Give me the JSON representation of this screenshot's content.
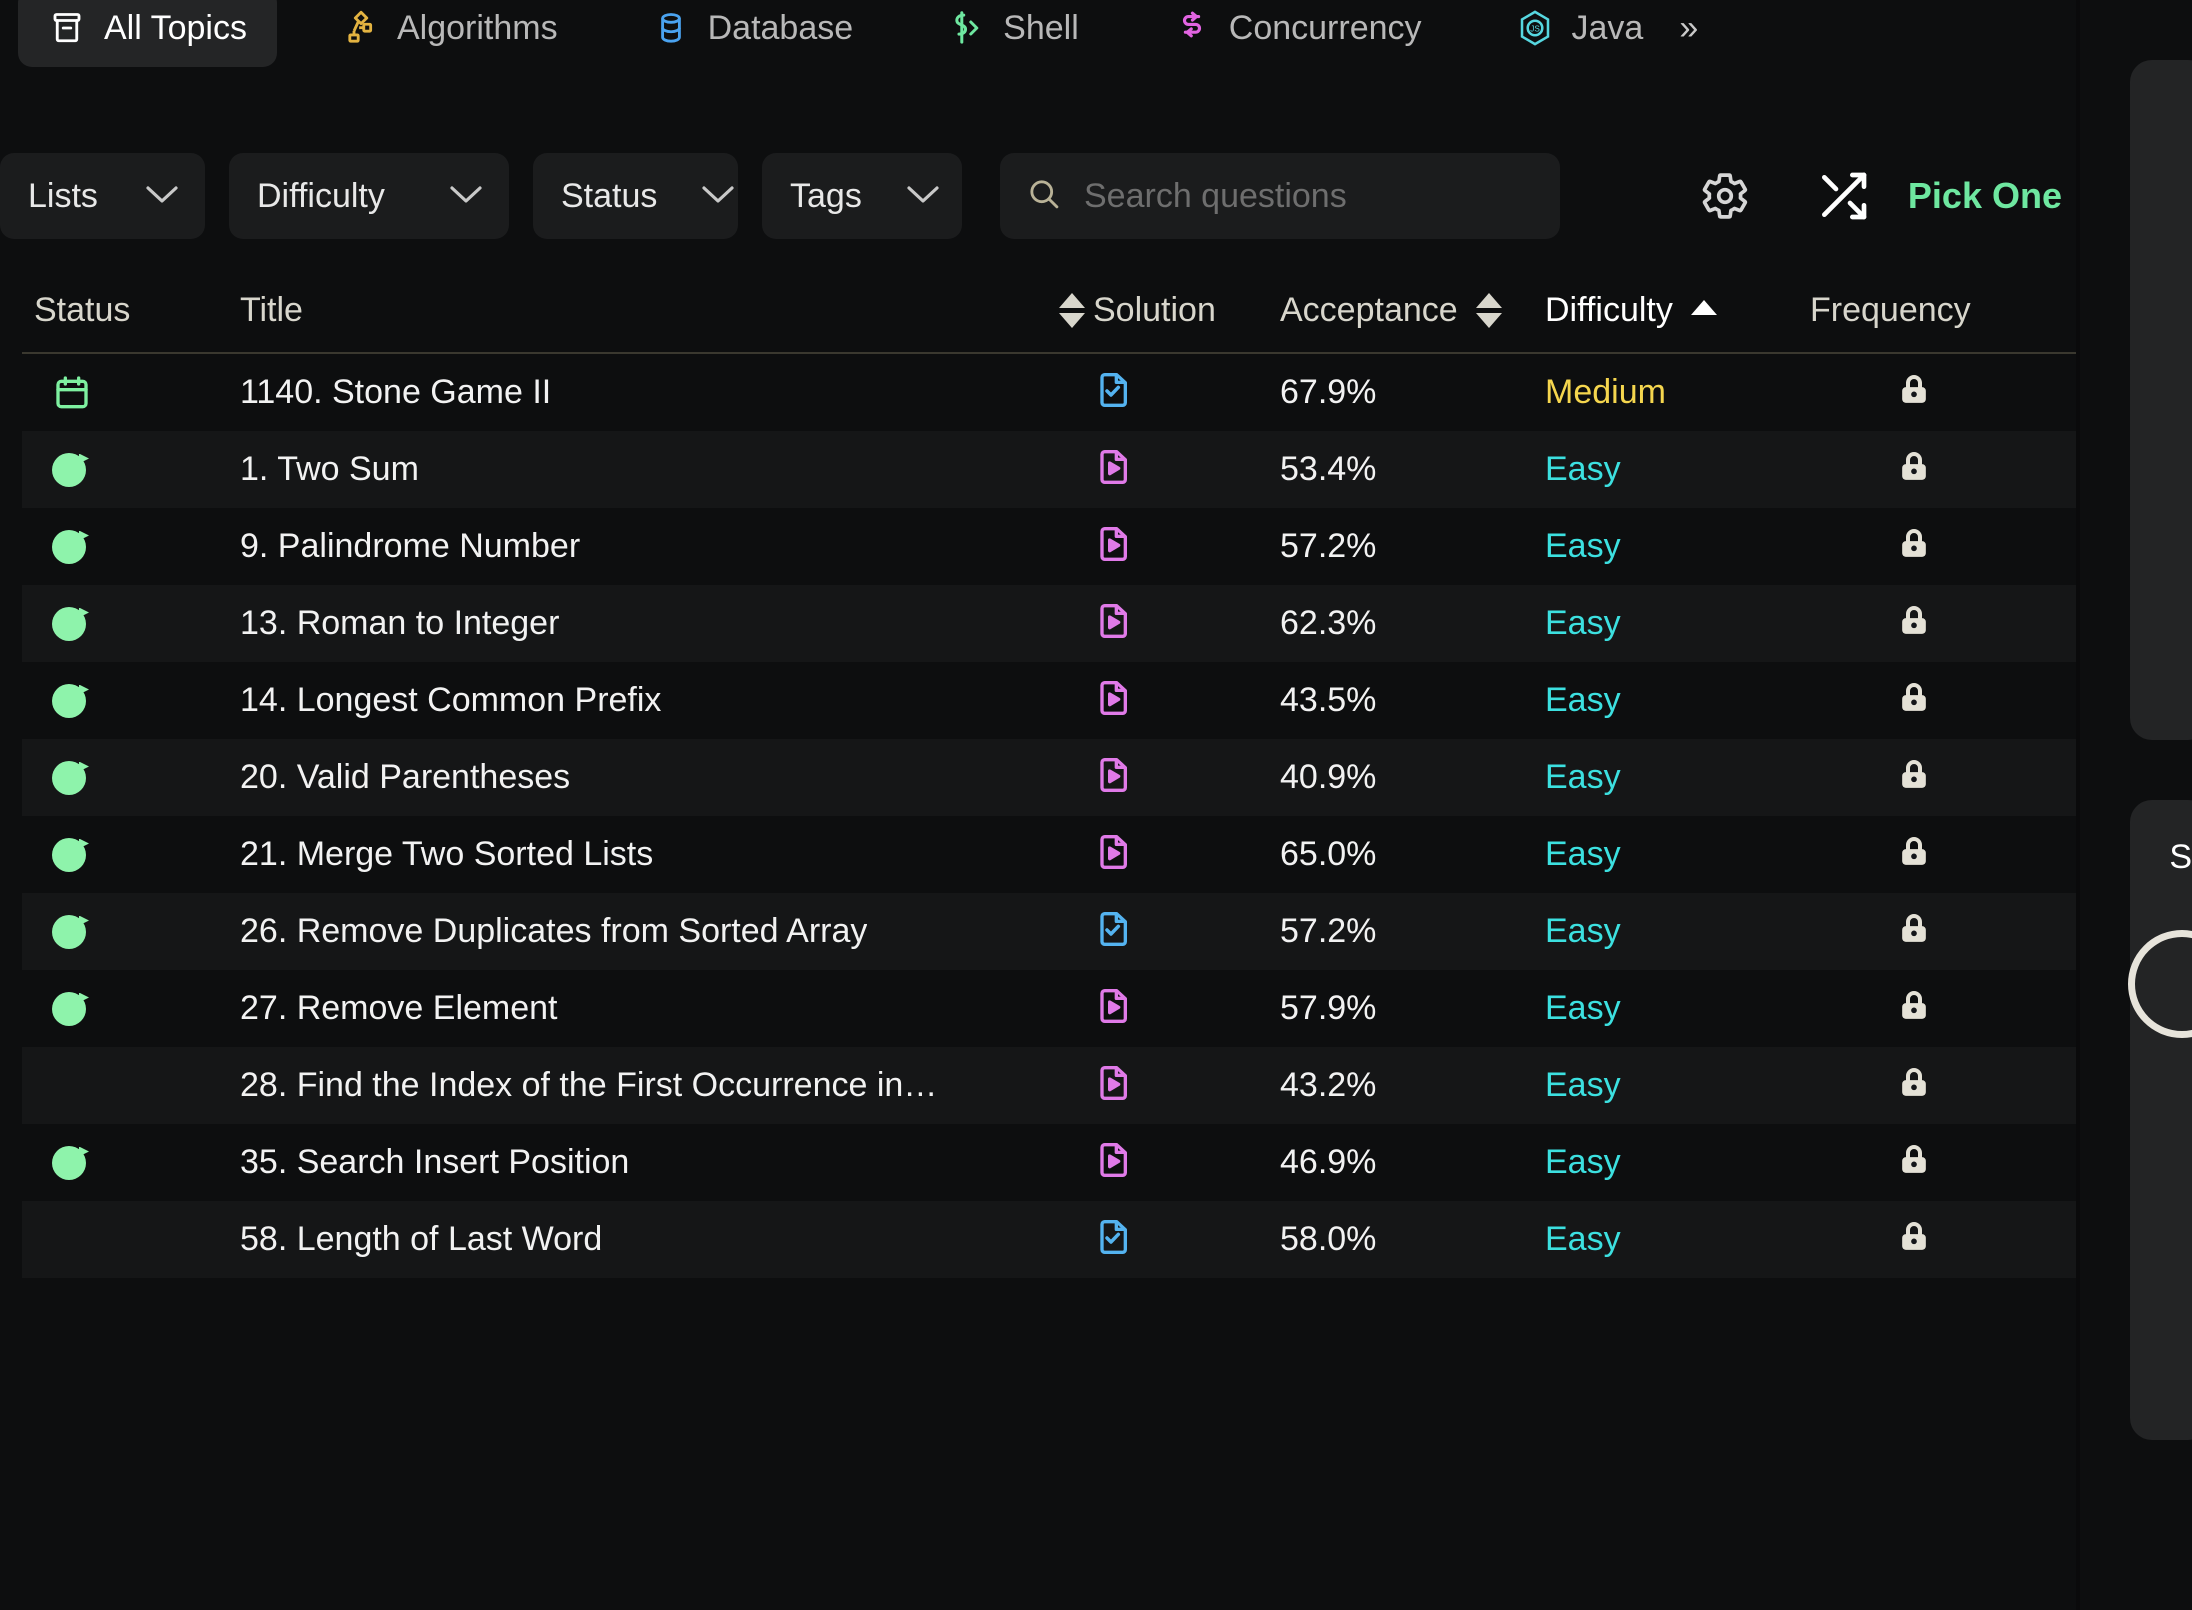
{
  "topics": [
    {
      "label": "All Topics",
      "icon": "archive-icon",
      "active": true,
      "color": "#ffffff"
    },
    {
      "label": "Algorithms",
      "icon": "algorithms-icon",
      "active": false,
      "color": "#e3b341"
    },
    {
      "label": "Database",
      "icon": "database-icon",
      "active": false,
      "color": "#4aa3f0"
    },
    {
      "label": "Shell",
      "icon": "shell-icon",
      "active": false,
      "color": "#6ee7a0"
    },
    {
      "label": "Concurrency",
      "icon": "concurrency-icon",
      "active": false,
      "color": "#e264e2"
    },
    {
      "label": "Java",
      "icon": "js-hexagon-icon",
      "active": false,
      "color": "#56d7e0"
    }
  ],
  "topics_more_label": "»",
  "filters": {
    "lists": {
      "label": "Lists",
      "caret": "⌄"
    },
    "difficulty": {
      "label": "Difficulty",
      "caret": "⌄"
    },
    "status": {
      "label": "Status",
      "caret": "⌄"
    },
    "tags": {
      "label": "Tags",
      "caret": "⌄"
    }
  },
  "search": {
    "value": "",
    "placeholder": "Search questions"
  },
  "actions": {
    "settings_icon": "gear-icon",
    "shuffle_icon": "shuffle-icon",
    "pick_one_label": "Pick One",
    "pick_one_color": "#6ee7a0"
  },
  "table": {
    "columns": {
      "status": "Status",
      "title": "Title",
      "solution": "Solution",
      "acceptance": "Acceptance",
      "difficulty": "Difficulty",
      "frequency": "Frequency"
    },
    "sort": {
      "active_column": "Difficulty",
      "direction": "asc"
    },
    "rows": [
      {
        "status": "daily",
        "status_icon": "calendar-icon",
        "title": "1140. Stone Game II",
        "solution_icon": "document-check-icon",
        "solution_type": "article",
        "acceptance": "67.9%",
        "difficulty": "Medium",
        "frequency_icon": "lock-icon"
      },
      {
        "status": "solved",
        "status_icon": "solved-check-icon",
        "title": "1. Two Sum",
        "solution_icon": "document-play-icon",
        "solution_type": "video",
        "acceptance": "53.4%",
        "difficulty": "Easy",
        "frequency_icon": "lock-icon"
      },
      {
        "status": "solved",
        "status_icon": "solved-check-icon",
        "title": "9. Palindrome Number",
        "solution_icon": "document-play-icon",
        "solution_type": "video",
        "acceptance": "57.2%",
        "difficulty": "Easy",
        "frequency_icon": "lock-icon"
      },
      {
        "status": "solved",
        "status_icon": "solved-check-icon",
        "title": "13. Roman to Integer",
        "solution_icon": "document-play-icon",
        "solution_type": "video",
        "acceptance": "62.3%",
        "difficulty": "Easy",
        "frequency_icon": "lock-icon"
      },
      {
        "status": "solved",
        "status_icon": "solved-check-icon",
        "title": "14. Longest Common Prefix",
        "solution_icon": "document-play-icon",
        "solution_type": "video",
        "acceptance": "43.5%",
        "difficulty": "Easy",
        "frequency_icon": "lock-icon"
      },
      {
        "status": "solved",
        "status_icon": "solved-check-icon",
        "title": "20. Valid Parentheses",
        "solution_icon": "document-play-icon",
        "solution_type": "video",
        "acceptance": "40.9%",
        "difficulty": "Easy",
        "frequency_icon": "lock-icon"
      },
      {
        "status": "solved",
        "status_icon": "solved-check-icon",
        "title": "21. Merge Two Sorted Lists",
        "solution_icon": "document-play-icon",
        "solution_type": "video",
        "acceptance": "65.0%",
        "difficulty": "Easy",
        "frequency_icon": "lock-icon"
      },
      {
        "status": "solved",
        "status_icon": "solved-check-icon",
        "title": "26. Remove Duplicates from Sorted Array",
        "solution_icon": "document-check-icon",
        "solution_type": "article",
        "acceptance": "57.2%",
        "difficulty": "Easy",
        "frequency_icon": "lock-icon"
      },
      {
        "status": "solved",
        "status_icon": "solved-check-icon",
        "title": "27. Remove Element",
        "solution_icon": "document-play-icon",
        "solution_type": "video",
        "acceptance": "57.9%",
        "difficulty": "Easy",
        "frequency_icon": "lock-icon"
      },
      {
        "status": "none",
        "status_icon": "",
        "title": "28. Find the Index of the First Occurrence in…",
        "solution_icon": "document-play-icon",
        "solution_type": "video",
        "acceptance": "43.2%",
        "difficulty": "Easy",
        "frequency_icon": "lock-icon"
      },
      {
        "status": "solved",
        "status_icon": "solved-check-icon",
        "title": "35. Search Insert Position",
        "solution_icon": "document-play-icon",
        "solution_type": "video",
        "acceptance": "46.9%",
        "difficulty": "Easy",
        "frequency_icon": "lock-icon"
      },
      {
        "status": "none",
        "status_icon": "",
        "title": "58. Length of Last Word",
        "solution_icon": "document-check-icon",
        "solution_type": "article",
        "acceptance": "58.0%",
        "difficulty": "Easy",
        "frequency_icon": "lock-icon"
      }
    ]
  },
  "edge": {
    "letter": "S"
  }
}
